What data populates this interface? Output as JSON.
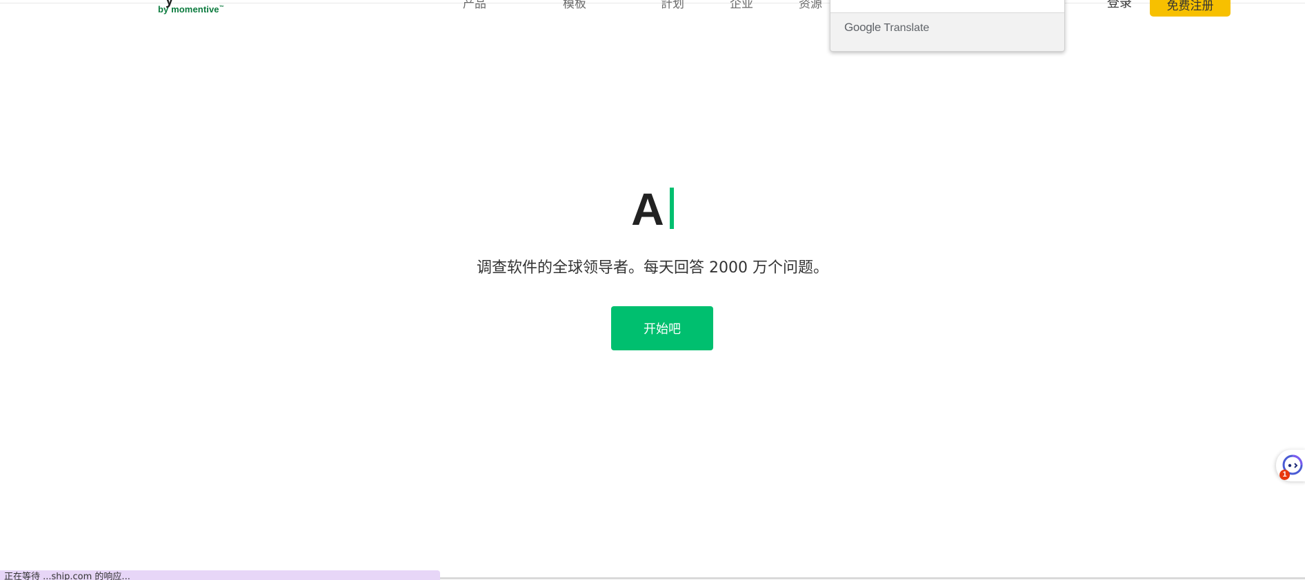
{
  "header": {
    "logo_sub": "by momentive",
    "logo_tm": "™",
    "logo_partial": "y",
    "nav_items": [
      "产品",
      "模板",
      "計划",
      "企业",
      "资源"
    ],
    "login": "登录",
    "signup": "免费注册"
  },
  "translate_popup": {
    "brand": "Google",
    "product": "Translate"
  },
  "hero": {
    "headline": "A",
    "tagline": "调查软件的全球领导者。每天回答 2000 万个问题。",
    "cta": "开始吧"
  },
  "assistant": {
    "badge": "1"
  },
  "status_bar": {
    "text": "正在等待 ...ship.com 的响应..."
  },
  "colors": {
    "accent_green": "#00bf6f",
    "logo_green": "#0a7a3d",
    "signup_yellow": "#f7c000",
    "status_bar": "#e7d6f7"
  }
}
